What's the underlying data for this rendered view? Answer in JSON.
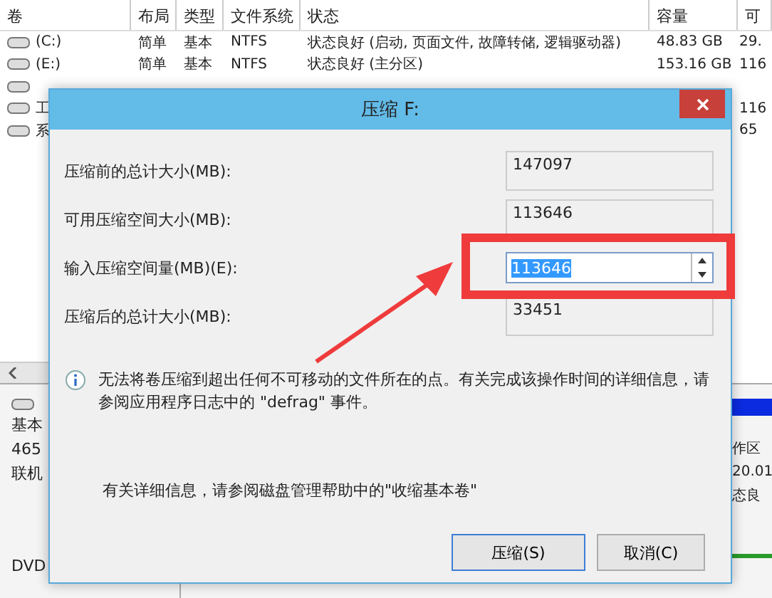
{
  "table": {
    "columns": [
      "卷",
      "布局",
      "类型",
      "文件系统",
      "状态",
      "容量",
      "可"
    ],
    "rows": [
      {
        "volume": "(C:)",
        "layout": "简单",
        "type": "基本",
        "fs": "NTFS",
        "status": "状态良好 (启动, 页面文件, 故障转储, 逻辑驱动器)",
        "capacity": "48.83 GB",
        "free": "29."
      },
      {
        "volume": "(E:)",
        "layout": "简单",
        "type": "基本",
        "fs": "NTFS",
        "status": "状态良好 (主分区)",
        "capacity": "153.16 GB",
        "free": "116"
      },
      {},
      {
        "volume": "工",
        "free": "116"
      },
      {
        "volume": "系",
        "free": "65"
      }
    ]
  },
  "disk_panel": {
    "disk_type": "基本",
    "size": "465",
    "status": "联机",
    "dvd": "DVD",
    "partition": {
      "name": "作区",
      "size": "20.01",
      "status": "态良"
    }
  },
  "dialog": {
    "title": "压缩 F:",
    "fields": [
      {
        "kind": "readonly",
        "label": "压缩前的总计大小(MB):",
        "value": "147097"
      },
      {
        "kind": "readonly",
        "label": "可用压缩空间大小(MB):",
        "value": "113646"
      },
      {
        "kind": "spin",
        "label": "输入压缩空间量(MB)(E):",
        "value": "113646",
        "selected": true
      },
      {
        "kind": "readonly",
        "label": "压缩后的总计大小(MB):",
        "value": "33451"
      }
    ],
    "info": "无法将卷压缩到超出任何不可移动的文件所在的点。有关完成该操作时间的详细信息，请参阅应用程序日志中的 \"defrag\" 事件。",
    "help": "有关详细信息，请参阅磁盘管理帮助中的\"收缩基本卷\"",
    "buttons": [
      {
        "label": "压缩(S)",
        "default": true
      },
      {
        "label": "取消(C)",
        "default": false
      }
    ]
  }
}
